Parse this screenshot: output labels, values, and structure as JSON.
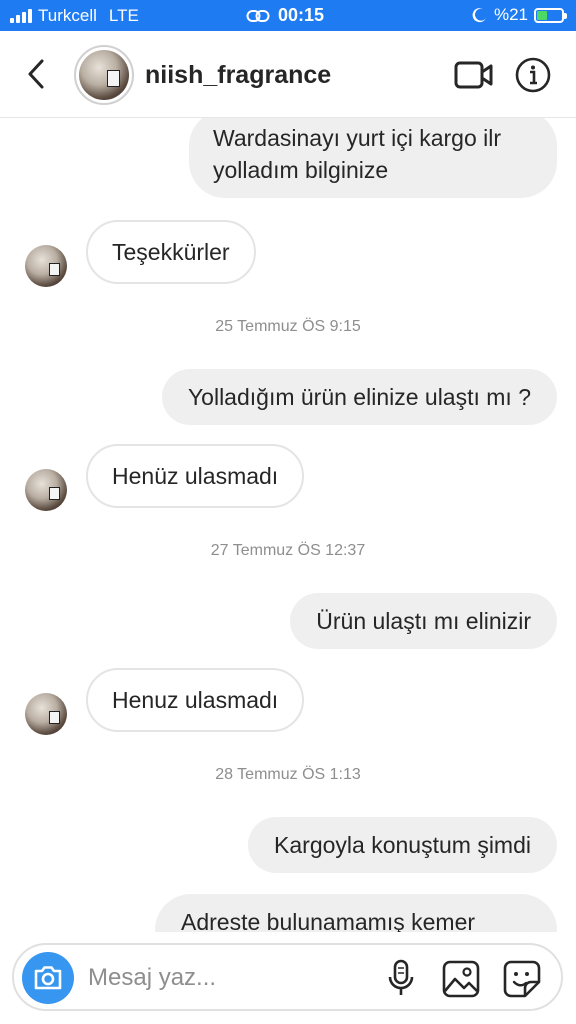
{
  "status_bar": {
    "carrier": "Turkcell",
    "network": "LTE",
    "time": "00:15",
    "battery": "%21"
  },
  "header": {
    "username": "niish_fragrance"
  },
  "messages": [
    {
      "type": "out",
      "text": "Wardasinayı yurt içi kargo ilr yolladım bilginize"
    },
    {
      "type": "in",
      "text": "Teşekkürler"
    },
    {
      "type": "timestamp",
      "text": "25 Temmuz ÖS 9:15"
    },
    {
      "type": "out",
      "text": "Yolladığım ürün elinize ulaştı mı ?"
    },
    {
      "type": "in",
      "text": "Henüz ulasmadı"
    },
    {
      "type": "timestamp",
      "text": "27 Temmuz ÖS 12:37"
    },
    {
      "type": "out",
      "text": "Ürün ulaştı mı elinizir"
    },
    {
      "type": "in",
      "text": "Henuz ulasmadı"
    },
    {
      "type": "timestamp",
      "text": "28 Temmuz ÖS 1:13"
    },
    {
      "type": "out",
      "text": "Kargoyla konuştum şimdi"
    },
    {
      "type": "out",
      "text": "Adreste bulunamamış kemer"
    }
  ],
  "composer": {
    "placeholder": "Mesaj yaz..."
  },
  "colors": {
    "status_bar": "#1e7bf2",
    "camera_button": "#3797f0",
    "outgoing_bubble": "#efefef"
  },
  "icons": [
    "back-chevron-icon",
    "video-call-icon",
    "info-icon",
    "camera-icon",
    "microphone-icon",
    "gallery-icon",
    "sticker-icon"
  ]
}
